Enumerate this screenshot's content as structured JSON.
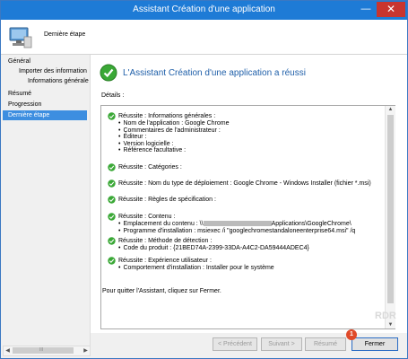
{
  "window": {
    "title": "Assistant Création d'une application",
    "minimize": "—",
    "close": "✕"
  },
  "header": {
    "page_title": "Dernière étape",
    "icon": "computer-wizard-icon"
  },
  "nav": {
    "items": [
      {
        "label": "Général"
      },
      {
        "label": "Importer des information"
      },
      {
        "label": "Informations générale"
      },
      {
        "label": "Résumé"
      },
      {
        "label": "Progression"
      },
      {
        "label": "Dernière étape"
      }
    ]
  },
  "nav_scroll": {
    "left": "◀",
    "right": "▶",
    "grip": "III"
  },
  "main": {
    "success_title": "L'Assistant Création d'une application a réussi",
    "details_label": "Détails :",
    "sections": [
      {
        "title": "Réussite : Informations générales :",
        "items": [
          "Nom de l'application : Google Chrome",
          "Commentaires de l'administrateur :",
          "Éditeur :",
          "Version logicielle :",
          "Référence facultative :"
        ]
      },
      {
        "title": "Réussite : Catégories :",
        "items": []
      },
      {
        "title": "Réussite : Nom du type de déploiement : Google Chrome - Windows Installer (fichier *.msi)",
        "items": []
      },
      {
        "title": "Réussite : Règles de spécification :",
        "items": []
      },
      {
        "title": "Réussite : Contenu :",
        "items": [
          "Emplacement du contenu : \\\\",
          "Programme d'installation : msiexec /i \"googlechromestandaloneenterprise64.msi\" /q"
        ],
        "content_path_tail": "Applications\\GoogleChrome\\"
      },
      {
        "title": "Réussite : Méthode de détection :",
        "items": [
          "Code du produit : {21BED74A-2399-33DA-A4C2-DA59444ADEC4}"
        ]
      },
      {
        "title": "Réussite : Expérience utilisateur :",
        "items": [
          "Comportement d'installation : Installer pour le système"
        ]
      }
    ],
    "quit_text": "Pour quitter l'Assistant, cliquez sur Fermer."
  },
  "details_scroll": {
    "up": "▲",
    "down": "▼"
  },
  "buttons": {
    "prev": "< Précédent",
    "next": "Suivant >",
    "summary": "Résumé",
    "close": "Fermer"
  },
  "badge": "1",
  "watermark": "RDR",
  "colors": {
    "accent": "#1e7bd6",
    "success": "#3aa836",
    "selection": "#3d8ee0",
    "title_blue": "#1f5fa9",
    "badge": "#e04a2a"
  }
}
